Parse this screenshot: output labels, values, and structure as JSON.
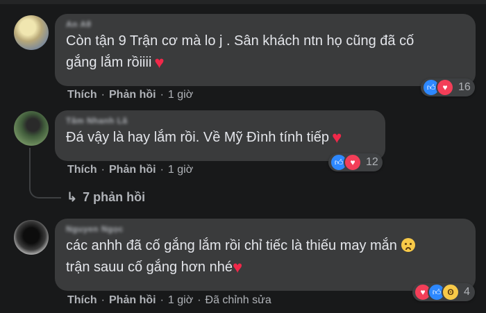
{
  "comments": [
    {
      "author": "An Aθ",
      "lines": [
        "Còn tận 9 Trận cơ mà lo j . Sân khách ntn họ cũng đã cố",
        "gắng lắm rồiiii"
      ],
      "actions": {
        "like": "Thích",
        "reply": "Phản hồi",
        "time": "1 giờ"
      },
      "reaction_count": "16"
    },
    {
      "author": "Tâm Nhanh Lã",
      "lines": [
        "Đá vậy là hay lắm rồi. Về Mỹ Đình tính tiếp"
      ],
      "actions": {
        "like": "Thích",
        "reply": "Phản hồi",
        "time": "1 giờ"
      },
      "reaction_count": "12",
      "replies_label": "7 phản hồi"
    },
    {
      "author": "Nguyen Ngọc",
      "lines": [
        "các anhh đã cố gắng lắm rồi chỉ tiếc là thiếu may mắn",
        "trận sauu cố gắng hơn nhé"
      ],
      "actions": {
        "like": "Thích",
        "reply": "Phản hồi",
        "time": "1 giờ",
        "edited": "Đã chỉnh sửa"
      },
      "reaction_count": "4"
    }
  ],
  "separator": "·",
  "icons": {
    "like": "thumbs-up-icon",
    "love": "heart-icon",
    "wow": "wow-face-icon",
    "reply_arrow": "reply-arrow-icon",
    "cry": "crying-face-icon"
  },
  "colors": {
    "background": "#18191a",
    "bubble": "#3a3b3c",
    "like": "#2d88ff",
    "love": "#f33e58",
    "muted": "#b0b3b8"
  }
}
